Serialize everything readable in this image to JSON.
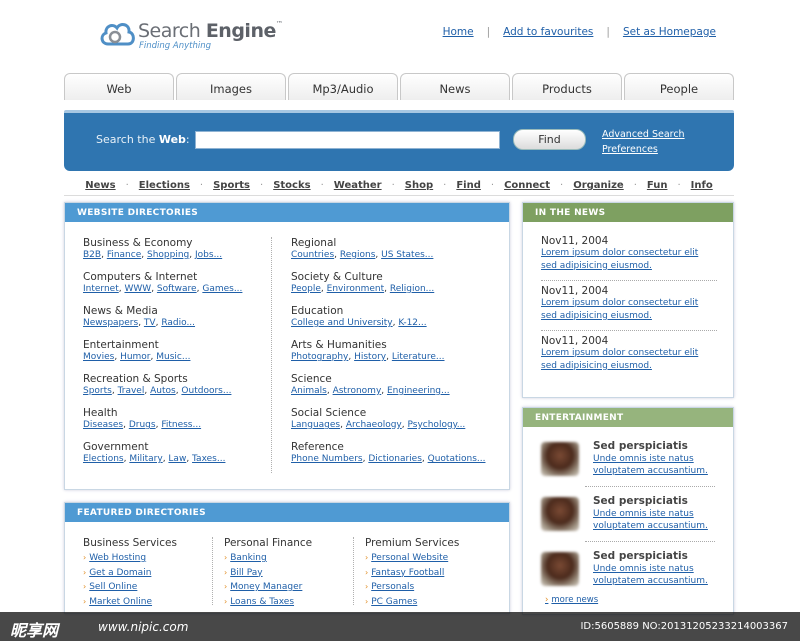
{
  "logo": {
    "name_light": "Search ",
    "name_bold": "Engine",
    "tm": "™",
    "tagline": "Finding Anything"
  },
  "toplinks": [
    "Home",
    "Add to favourites",
    "Set as Homepage"
  ],
  "tabs": [
    "Web",
    "Images",
    "Mp3/Audio",
    "News",
    "Products",
    "People"
  ],
  "search": {
    "label_prefix": "Search the ",
    "label_bold": "Web",
    "label_suffix": ":",
    "value": "",
    "placeholder": "",
    "button": "Find",
    "advanced": "Advanced Search",
    "preferences": "Preferences"
  },
  "subnav": [
    "News",
    "Elections",
    "Sports",
    "Stocks",
    "Weather",
    "Shop",
    "Find",
    "Connect",
    "Organize",
    "Fun",
    "Info"
  ],
  "directories": {
    "title": "WEBSITE DIRECTORIES",
    "left": [
      {
        "title": "Business & Economy",
        "links": [
          "B2B",
          "Finance",
          "Shopping",
          "Jobs..."
        ]
      },
      {
        "title": "Computers & Internet",
        "links": [
          "Internet",
          "WWW",
          "Software",
          "Games..."
        ]
      },
      {
        "title": "News & Media",
        "links": [
          "Newspapers",
          "TV",
          "Radio..."
        ]
      },
      {
        "title": "Entertainment",
        "links": [
          "Movies",
          "Humor",
          "Music..."
        ]
      },
      {
        "title": "Recreation & Sports",
        "links": [
          "Sports",
          "Travel",
          "Autos",
          "Outdoors..."
        ]
      },
      {
        "title": "Health",
        "links": [
          "Diseases",
          "Drugs",
          "Fitness..."
        ]
      },
      {
        "title": "Government",
        "links": [
          "Elections",
          "Military",
          "Law",
          "Taxes..."
        ]
      }
    ],
    "right": [
      {
        "title": "Regional",
        "links": [
          "Countries",
          "Regions",
          "US States..."
        ]
      },
      {
        "title": "Society & Culture",
        "links": [
          "People",
          "Environment",
          "Religion..."
        ]
      },
      {
        "title": "Education",
        "links": [
          "College and University",
          "K-12..."
        ]
      },
      {
        "title": "Arts & Humanities",
        "links": [
          "Photography",
          "History",
          "Literature..."
        ]
      },
      {
        "title": "Science",
        "links": [
          "Animals",
          "Astronomy",
          "Engineering..."
        ]
      },
      {
        "title": "Social Science",
        "links": [
          "Languages",
          "Archaeology",
          "Psychology..."
        ]
      },
      {
        "title": "Reference",
        "links": [
          "Phone Numbers",
          "Dictionaries",
          "Quotations..."
        ]
      }
    ]
  },
  "featured": {
    "title": "FEATURED DIRECTORIES",
    "cols": [
      {
        "title": "Business Services",
        "links": [
          "Web Hosting",
          "Get a Domain",
          "Sell Online",
          "Market Online"
        ]
      },
      {
        "title": "Personal Finance",
        "links": [
          "Banking",
          "Bill Pay",
          "Money Manager",
          "Loans & Taxes"
        ]
      },
      {
        "title": "Premium Services",
        "links": [
          "Personal Website",
          "Fantasy Football",
          "Personals",
          "PC Games"
        ]
      }
    ]
  },
  "news": {
    "title": "IN THE NEWS",
    "items": [
      {
        "date": "Nov11, 2004",
        "line1": "Lorem ipsum dolor consectetur elit",
        "line2": "sed adipisicing eiusmod."
      },
      {
        "date": "Nov11, 2004",
        "line1": "Lorem ipsum dolor consectetur elit",
        "line2": "sed adipisicing eiusmod."
      },
      {
        "date": "Nov11, 2004",
        "line1": "Lorem ipsum dolor consectetur elit",
        "line2": "sed adipisicing eiusmod."
      }
    ]
  },
  "entertainment": {
    "title": "ENTERTAINMENT",
    "items": [
      {
        "title": "Sed perspiciatis",
        "line1": "Unde omnis iste natus",
        "line2": "voluptatem accusantium."
      },
      {
        "title": "Sed perspiciatis",
        "line1": "Unde omnis iste natus",
        "line2": "voluptatem accusantium."
      },
      {
        "title": "Sed perspiciatis",
        "line1": "Unde omnis iste natus",
        "line2": "voluptatem accusantium."
      }
    ],
    "more": "more news"
  },
  "footer": {
    "wm_left": "昵享网",
    "wm_url": "www.nipic.com",
    "wm_id": "ID:5605889 NO:20131205233214003367"
  }
}
